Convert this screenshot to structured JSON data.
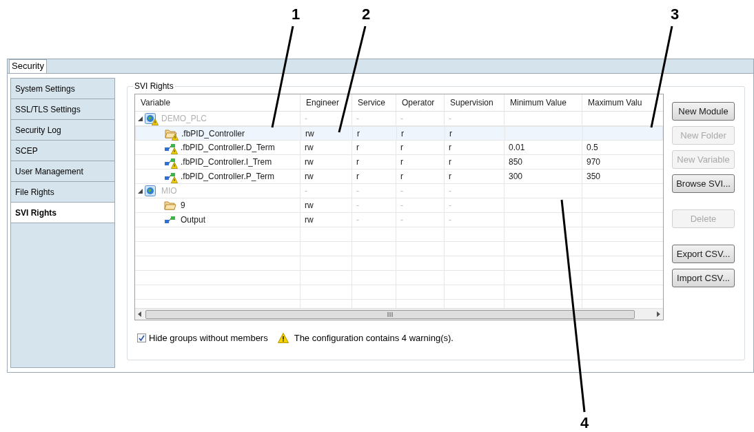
{
  "callouts": [
    {
      "label": "1"
    },
    {
      "label": "2"
    },
    {
      "label": "3"
    },
    {
      "label": "4"
    }
  ],
  "window": {
    "tab": {
      "label": "Security",
      "selected": true
    }
  },
  "sidebar": {
    "items": [
      {
        "label": "System Settings",
        "selected": false
      },
      {
        "label": "SSL/TLS Settings",
        "selected": false
      },
      {
        "label": "Security Log",
        "selected": false
      },
      {
        "label": "SCEP",
        "selected": false
      },
      {
        "label": "User Management",
        "selected": false
      },
      {
        "label": "File Rights",
        "selected": false
      },
      {
        "label": "SVI Rights",
        "selected": true
      }
    ]
  },
  "group": {
    "title": "SVI Rights"
  },
  "table": {
    "columns": [
      "Variable",
      "Engineer",
      "Service",
      "Operator",
      "Supervision",
      "Minimum Value",
      "Maximum Valu"
    ],
    "rows": [
      {
        "kind": "module",
        "name": "DEMO_PLC",
        "disabled": true,
        "warning": true,
        "expanded": true,
        "selected": false,
        "cells": [
          {
            "text": "-",
            "disabled": true
          },
          {
            "text": "-",
            "disabled": true
          },
          {
            "text": "-",
            "disabled": true
          },
          {
            "text": "-",
            "disabled": true
          }
        ],
        "children": [
          {
            "kind": "folder",
            "name": ".fbPID_Controller",
            "disabled": false,
            "warning": true,
            "selected": true,
            "cells": [
              {
                "text": "rw",
                "disabled": false
              },
              {
                "text": "r",
                "disabled": false
              },
              {
                "text": "r",
                "disabled": false
              },
              {
                "text": "r",
                "disabled": false
              }
            ]
          },
          {
            "kind": "variable",
            "name": ".fbPID_Controller.D_Term",
            "disabled": false,
            "warning": true,
            "selected": false,
            "cells": [
              {
                "text": "rw",
                "disabled": false
              },
              {
                "text": "r",
                "disabled": false
              },
              {
                "text": "r",
                "disabled": false
              },
              {
                "text": "r",
                "disabled": false
              },
              {
                "text": "0.01",
                "disabled": false
              },
              {
                "text": "0.5",
                "disabled": false
              }
            ]
          },
          {
            "kind": "variable",
            "name": ".fbPID_Controller.I_Trem",
            "disabled": false,
            "warning": true,
            "selected": false,
            "cells": [
              {
                "text": "rw",
                "disabled": false
              },
              {
                "text": "r",
                "disabled": false
              },
              {
                "text": "r",
                "disabled": false
              },
              {
                "text": "r",
                "disabled": false
              },
              {
                "text": "850",
                "disabled": false
              },
              {
                "text": "970",
                "disabled": false
              }
            ]
          },
          {
            "kind": "variable",
            "name": ".fbPID_Controller.P_Term",
            "disabled": false,
            "warning": true,
            "selected": false,
            "cells": [
              {
                "text": "rw",
                "disabled": false
              },
              {
                "text": "r",
                "disabled": false
              },
              {
                "text": "r",
                "disabled": false
              },
              {
                "text": "r",
                "disabled": false
              },
              {
                "text": "300",
                "disabled": false
              },
              {
                "text": "350",
                "disabled": false
              }
            ]
          }
        ]
      },
      {
        "kind": "module",
        "name": "MIO",
        "disabled": true,
        "warning": false,
        "expanded": true,
        "selected": false,
        "cells": [
          {
            "text": "-",
            "disabled": true
          },
          {
            "text": "-",
            "disabled": true
          },
          {
            "text": "-",
            "disabled": true
          },
          {
            "text": "-",
            "disabled": true
          }
        ],
        "children": [
          {
            "kind": "folder",
            "name": "9",
            "disabled": false,
            "warning": false,
            "selected": false,
            "cells": [
              {
                "text": "rw",
                "disabled": false
              },
              {
                "text": "-",
                "disabled": true
              },
              {
                "text": "-",
                "disabled": true
              },
              {
                "text": "-",
                "disabled": true
              }
            ]
          },
          {
            "kind": "variable",
            "name": "Output",
            "disabled": false,
            "warning": false,
            "selected": false,
            "cells": [
              {
                "text": "rw",
                "disabled": false
              },
              {
                "text": "-",
                "disabled": true
              },
              {
                "text": "-",
                "disabled": true
              },
              {
                "text": "-",
                "disabled": true
              }
            ]
          }
        ]
      }
    ]
  },
  "button_groups": [
    [
      {
        "label": "New Module",
        "disabled": false
      },
      {
        "label": "New Folder",
        "disabled": true
      },
      {
        "label": "New Variable",
        "disabled": true
      },
      {
        "label": "Browse SVI...",
        "disabled": false
      }
    ],
    [
      {
        "label": "Delete",
        "disabled": true
      }
    ],
    [
      {
        "label": "Export CSV...",
        "disabled": false
      },
      {
        "label": "Import CSV...",
        "disabled": false
      }
    ]
  ],
  "footer": {
    "checkbox": {
      "label": "Hide groups without members",
      "checked": true
    },
    "message": {
      "text": "The configuration contains 4 warning(s)."
    }
  }
}
